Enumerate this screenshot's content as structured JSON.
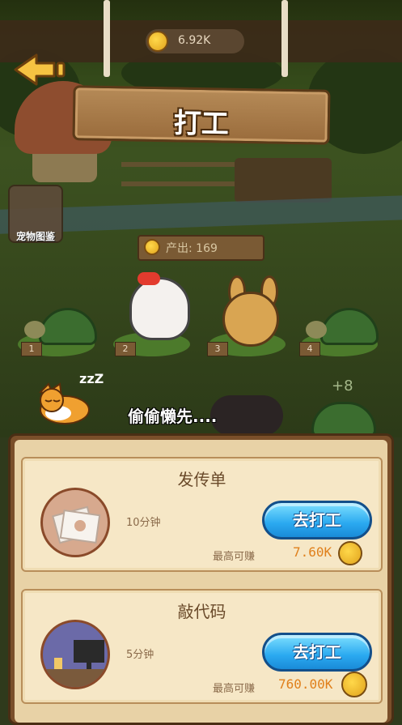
{
  "header": {
    "coin_value": "6.92K",
    "title": "打工"
  },
  "sidebar": {
    "pet_book_label": "宠物图鉴"
  },
  "scene": {
    "output_label": "产出: 169",
    "slot_numbers": [
      "1",
      "2",
      "3",
      "4"
    ],
    "plus_bonus": "+8",
    "zzz": "zzZ",
    "sleep_message": "偷偷懒先...."
  },
  "jobs": [
    {
      "title": "发传单",
      "duration": "10分钟",
      "button_label": "去打工",
      "earn_label": "最高可赚",
      "earn_value": "7.60K",
      "icon": "flyers-icon"
    },
    {
      "title": "敲代码",
      "duration": "5分钟",
      "button_label": "去打工",
      "earn_label": "最高可赚",
      "earn_value": "760.00K",
      "icon": "computer-icon"
    }
  ],
  "colors": {
    "accent_button": "#2aa9f0",
    "earn_value": "#e0801c",
    "panel_bg": "#e8d2a6"
  }
}
